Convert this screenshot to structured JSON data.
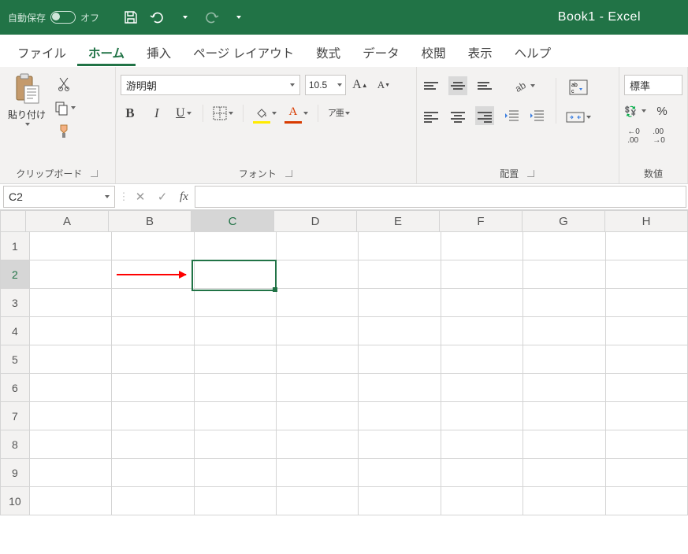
{
  "title": {
    "autosave_label": "自動保存",
    "autosave_state": "オフ",
    "doc": "Book1",
    "app": "Excel"
  },
  "tabs": [
    "ファイル",
    "ホーム",
    "挿入",
    "ページ レイアウト",
    "数式",
    "データ",
    "校閲",
    "表示",
    "ヘルプ"
  ],
  "active_tab": 1,
  "clipboard": {
    "paste": "貼り付け",
    "group": "クリップボード"
  },
  "font": {
    "name": "游明朝",
    "size": "10.5",
    "group": "フォント",
    "ruby": "ア亜"
  },
  "align": {
    "group": "配置"
  },
  "number": {
    "group": "数値",
    "format": "標準"
  },
  "namebox": "C2",
  "columns": [
    "A",
    "B",
    "C",
    "D",
    "E",
    "F",
    "G",
    "H"
  ],
  "rows": [
    "1",
    "2",
    "3",
    "4",
    "5",
    "6",
    "7",
    "8",
    "9",
    "10"
  ],
  "active": {
    "col": 2,
    "row": 1
  }
}
